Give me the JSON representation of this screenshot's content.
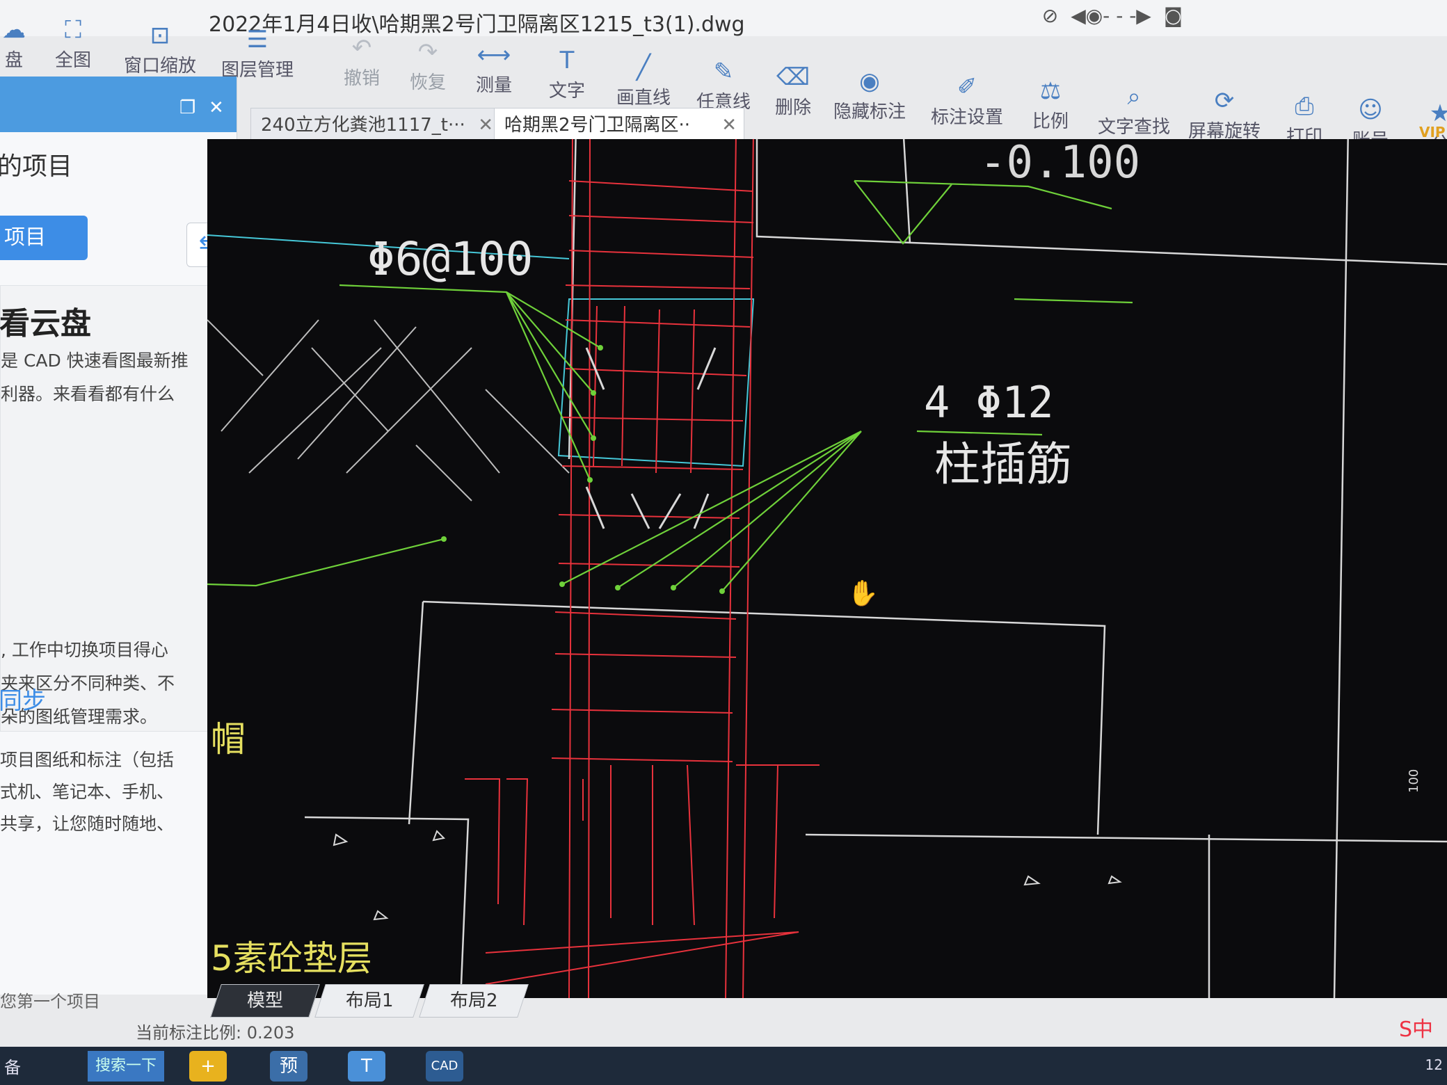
{
  "window": {
    "title": "2022年1月4日收\\哈期黑2号门卫隔离区1215_t3(1).dwg"
  },
  "toolbar": {
    "items": [
      {
        "label": "盘",
        "icon": "cloud-icon",
        "enabled": true
      },
      {
        "label": "全图",
        "icon": "fit-all-icon",
        "enabled": true
      },
      {
        "label": "窗口缩放",
        "icon": "zoom-window-icon",
        "enabled": true
      },
      {
        "label": "图层管理",
        "icon": "layers-icon",
        "enabled": true
      },
      {
        "label": "撤销",
        "icon": "undo-icon",
        "enabled": false
      },
      {
        "label": "恢复",
        "icon": "redo-icon",
        "enabled": false
      },
      {
        "label": "测量",
        "icon": "measure-icon",
        "enabled": true
      },
      {
        "label": "文字",
        "icon": "text-icon",
        "enabled": true
      },
      {
        "label": "画直线",
        "icon": "line-icon",
        "enabled": true
      },
      {
        "label": "任意线",
        "icon": "freehand-icon",
        "enabled": true
      },
      {
        "label": "删除",
        "icon": "eraser-icon",
        "enabled": true
      },
      {
        "label": "隐藏标注",
        "icon": "eye-hide-icon",
        "enabled": true
      },
      {
        "label": "标注设置",
        "icon": "annotation-settings-icon",
        "enabled": true
      },
      {
        "label": "比例",
        "icon": "scale-icon",
        "enabled": true
      },
      {
        "label": "文字查找",
        "icon": "text-search-icon",
        "enabled": true
      },
      {
        "label": "屏幕旋转",
        "icon": "rotate-screen-icon",
        "enabled": true
      },
      {
        "label": "打印",
        "icon": "print-icon",
        "enabled": true
      },
      {
        "label": "账号",
        "icon": "account-icon",
        "enabled": true
      },
      {
        "label": "公",
        "icon": "vip-icon",
        "enabled": true
      }
    ],
    "vip_badge": "VIP"
  },
  "panel": {
    "title": "的项目",
    "project_button": "项目",
    "cloud_title": "看云盘",
    "cloud_desc": [
      "是 CAD 快速看图最新推",
      "利器。来看看都有什么"
    ],
    "benefit_desc": [
      ", 工作中切换项目得心",
      "夹来区分不同种类、不",
      "朵的图纸管理需求。"
    ],
    "sync_title": "同步",
    "sync_desc": [
      "项目图纸和标注（包括",
      "式机、笔记本、手机、",
      "共享，让您随时随地、"
    ],
    "first_project": "您第一个项目"
  },
  "tabs": [
    {
      "label": "240立方化粪池1117_t···",
      "active": false
    },
    {
      "label": "哈期黑2号门卫隔离区··",
      "active": true
    }
  ],
  "drawing": {
    "labels": {
      "rebar_spacing": "Φ6@100",
      "rebar_count": "4 Φ12",
      "column_rebar": "柱插筋",
      "elevation": "-0.100",
      "concrete_layer": "5素砼垫层",
      "cap_partial": "帽",
      "dim_small": "100"
    },
    "colors": {
      "background": "#0b0b0d",
      "rebar_red": "#e8323c",
      "leader_green": "#6fd13a",
      "outline_white": "#d8d8d8",
      "cyan": "#46c8d8"
    }
  },
  "layout_tabs": [
    {
      "label": "模型",
      "active": true
    },
    {
      "label": "布局1",
      "active": false
    },
    {
      "label": "布局2",
      "active": false
    }
  ],
  "status": {
    "scale_text": "当前标注比例: 0.203",
    "ime": "S中"
  },
  "taskbar": {
    "start": "备",
    "search": "搜索一下",
    "apps": [
      {
        "icon": "browser-icon",
        "label": "+",
        "color": "#e8b21e"
      },
      {
        "icon": "preview-icon",
        "label": "预",
        "color": "#3b6ea8"
      },
      {
        "icon": "text-app-icon",
        "label": "T",
        "color": "#4a90d8"
      },
      {
        "icon": "cad-app-icon",
        "label": "CAD",
        "color": "#2d5c92"
      }
    ],
    "clock_partial": "12"
  }
}
